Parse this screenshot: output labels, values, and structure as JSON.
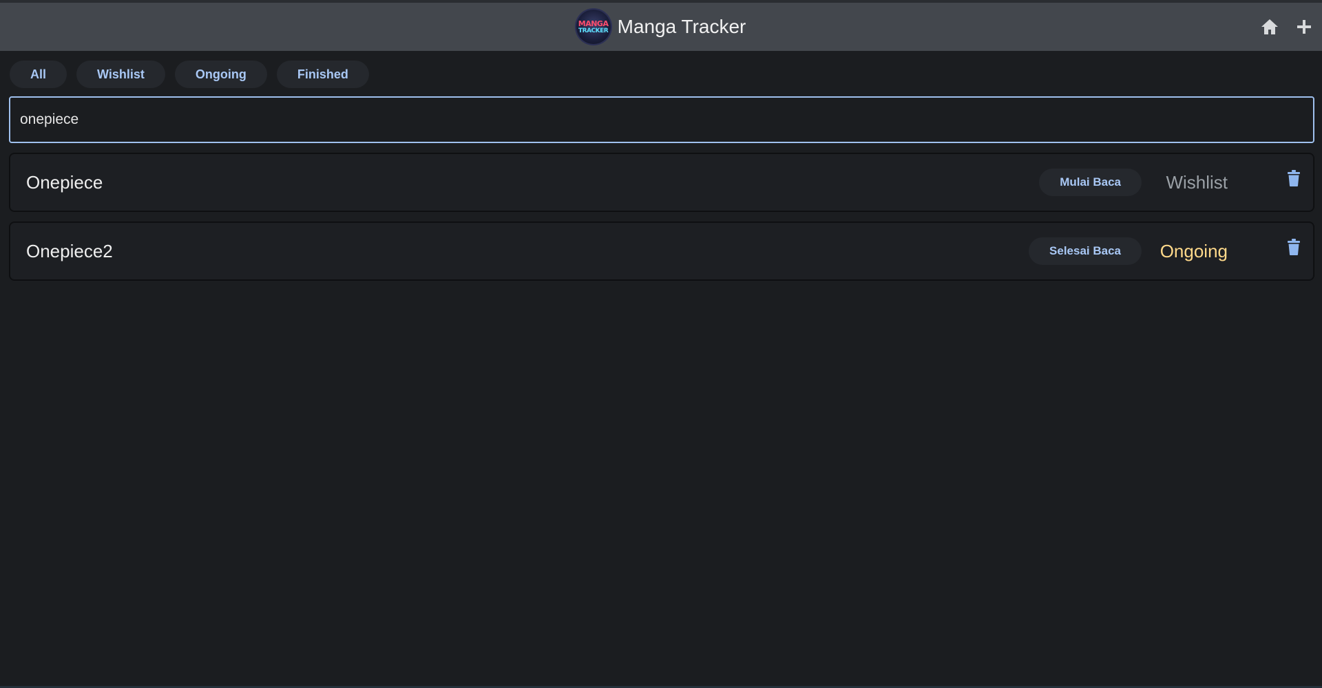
{
  "header": {
    "logo_text_top": "MANGA",
    "logo_text_bottom": "TRACKER",
    "title": "Manga Tracker",
    "icons": [
      "home-icon",
      "plus-icon"
    ],
    "accent_color": "#9fc0ee"
  },
  "filters": [
    {
      "label": "All"
    },
    {
      "label": "Wishlist"
    },
    {
      "label": "Ongoing"
    },
    {
      "label": "Finished"
    }
  ],
  "search": {
    "value": "onepiece",
    "placeholder": ""
  },
  "list": [
    {
      "title": "Onepiece",
      "action_label": "Mulai Baca",
      "status": "Wishlist",
      "status_color": "#9aa0a6"
    },
    {
      "title": "Onepiece2",
      "action_label": "Selesai Baca",
      "status": "Ongoing",
      "status_color": "#ffd98a"
    }
  ]
}
